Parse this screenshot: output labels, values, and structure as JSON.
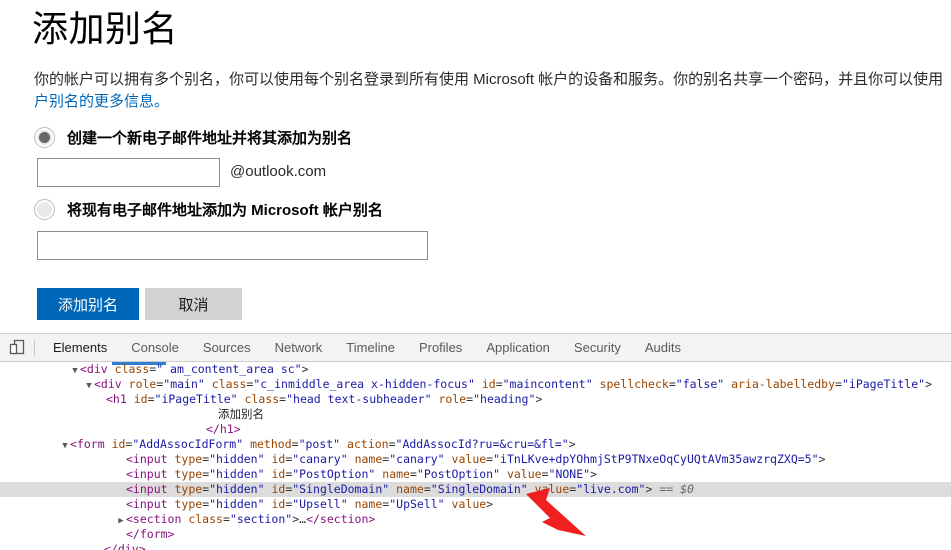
{
  "page": {
    "title": "添加别名",
    "description_line1": "你的帐户可以拥有多个别名，你可以使用每个别名登录到所有使用 Microsoft 帐户的设备和服务。你的别名共享一个密码，并且你可以使用",
    "description_line2_link": "户别名的更多信息。",
    "option_new": {
      "label": "创建一个新电子邮件地址并将其添加为别名",
      "selected": true,
      "input_value": "",
      "input_placeholder": "",
      "domain_suffix": "@outlook.com"
    },
    "option_existing": {
      "label": "将现有电子邮件地址添加为 Microsoft 帐户别名",
      "selected": false,
      "input_value": "",
      "input_placeholder": ""
    },
    "submit_label": "添加别名",
    "cancel_label": "取消",
    "accent_color": "#0067b8",
    "cancel_color": "#d2d2d2"
  },
  "devtools": {
    "device_toolbar_icon": "device-toolbar-icon",
    "tabs": [
      {
        "label": "Elements",
        "active": true
      },
      {
        "label": "Console",
        "active": false
      },
      {
        "label": "Sources",
        "active": false
      },
      {
        "label": "Network",
        "active": false
      },
      {
        "label": "Timeline",
        "active": false
      },
      {
        "label": "Profiles",
        "active": false
      },
      {
        "label": "Application",
        "active": false
      },
      {
        "label": "Security",
        "active": false
      },
      {
        "label": "Audits",
        "active": false
      }
    ],
    "dom": {
      "line1": {
        "twisty": "▼",
        "tag_open": "<div",
        "attr1": "class",
        "val1": "\" am_content_area sc\"",
        "close": ">"
      },
      "line2": {
        "twisty": "▼",
        "tag_open": "<div",
        "attr1": "role",
        "val1": "\"main\"",
        "attr2": "class",
        "val2": "\"c_inmiddle_area x-hidden-focus\"",
        "attr3": "id",
        "val3": "\"maincontent\"",
        "attr4": "spellcheck",
        "val4": "\"false\"",
        "attr5": "aria-labelledby",
        "val5": "\"iPageTitle\"",
        "close": ">"
      },
      "line3": {
        "tag_open": "<h1",
        "attr1": "id",
        "val1": "\"iPageTitle\"",
        "attr2": "class",
        "val2": "\"head text-subheader\"",
        "attr3": "role",
        "val3": "\"heading\"",
        "close": ">"
      },
      "line4_text": "添加别名",
      "line5_closeh1": "</h1>",
      "line6": {
        "twisty": "▼",
        "tag_open": "<form",
        "attr1": "id",
        "val1": "\"AddAssocIdForm\"",
        "attr2": "method",
        "val2": "\"post\"",
        "attr3": "action",
        "val3": "\"AddAssocId?ru=&cru=&fl=\"",
        "close": ">"
      },
      "line7": {
        "tag_open": "<input",
        "attr1": "type",
        "val1": "\"hidden\"",
        "attr2": "id",
        "val2": "\"canary\"",
        "attr3": "name",
        "val3": "\"canary\"",
        "attr4": "value",
        "val4": "\"iTnLKve+dpYOhmjStP9TNxeOqCyUQtAVm35awzrqZXQ=5\"",
        "close": ">"
      },
      "line8": {
        "tag_open": "<input",
        "attr1": "type",
        "val1": "\"hidden\"",
        "attr2": "id",
        "val2": "\"PostOption\"",
        "attr3": "name",
        "val3": "\"PostOption\"",
        "attr4": "value",
        "val4": "\"NONE\"",
        "close": ">"
      },
      "line9": {
        "tag_open": "<input",
        "attr1": "type",
        "val1": "\"hidden\"",
        "attr2": "id",
        "val2": "\"SingleDomain\"",
        "attr3": "name",
        "val3": "\"SingleDomain\"",
        "attr4": "value",
        "val4": "\"live.com\"",
        "close": ">",
        "selected_marker": "== $0",
        "selected": true
      },
      "line10": {
        "tag_open": "<input",
        "attr1": "type",
        "val1": "\"hidden\"",
        "attr2": "id",
        "val2": "\"Upsell\"",
        "attr3": "name",
        "val3": "\"UpSell\"",
        "attr4": "value",
        "close": ">"
      },
      "line11": {
        "twisty": "▶",
        "tag_open": "<section",
        "attr1": "class",
        "val1": "\"section\"",
        "close": ">",
        "ellipsis": "…",
        "tag_close": "</section>"
      },
      "line12_closeform": "</form>",
      "line13_closediv": "</div>"
    },
    "annotation": {
      "arrow": "red-arrow-annotation",
      "arrow_color": "#f02020",
      "points_at": "live.com"
    }
  }
}
